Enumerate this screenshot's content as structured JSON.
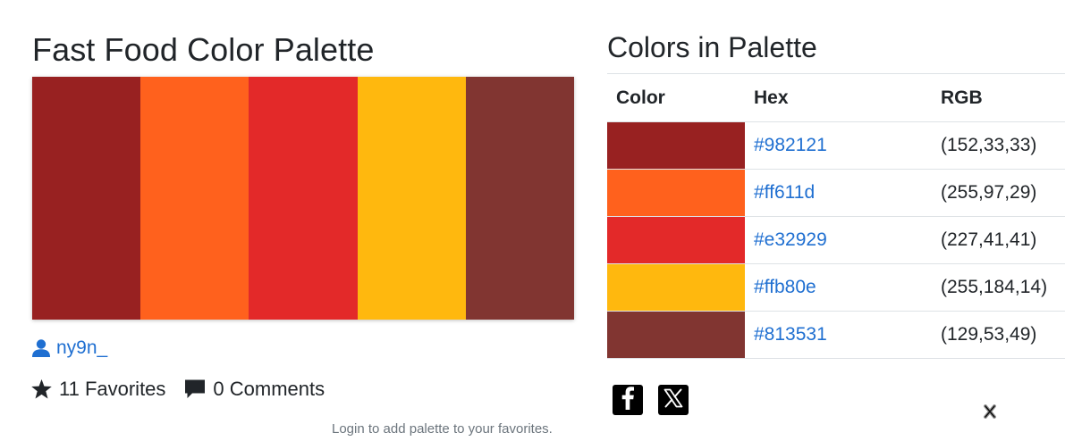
{
  "page": {
    "title": "Fast Food Color Palette"
  },
  "palette": {
    "swatches": [
      {
        "hex": "#982121"
      },
      {
        "hex": "#ff611d"
      },
      {
        "hex": "#e32929"
      },
      {
        "hex": "#ffb80e"
      },
      {
        "hex": "#813531"
      }
    ]
  },
  "author": {
    "icon": "user-icon",
    "name": "ny9n_"
  },
  "stats": {
    "favorites": {
      "icon": "star-icon",
      "label": "11 Favorites"
    },
    "comments": {
      "icon": "comment-icon",
      "label": "0 Comments"
    }
  },
  "login_note": "Login to add palette to your favorites.",
  "colors_panel": {
    "title": "Colors in Palette",
    "headers": {
      "color": "Color",
      "hex": "Hex",
      "rgb": "RGB"
    },
    "rows": [
      {
        "hex": "#982121",
        "rgb": "(152,33,33)"
      },
      {
        "hex": "#ff611d",
        "rgb": "(255,97,29)"
      },
      {
        "hex": "#e32929",
        "rgb": "(227,41,41)"
      },
      {
        "hex": "#ffb80e",
        "rgb": "(255,184,14)"
      },
      {
        "hex": "#813531",
        "rgb": "(129,53,49)"
      }
    ]
  },
  "share": {
    "buttons": [
      {
        "icon": "facebook-icon"
      },
      {
        "icon": "x-icon"
      }
    ]
  },
  "ad": {
    "close_icon": "close-icon"
  },
  "colors": {
    "link": "#1f6fd1",
    "text": "#212529",
    "muted": "#6c757d"
  }
}
